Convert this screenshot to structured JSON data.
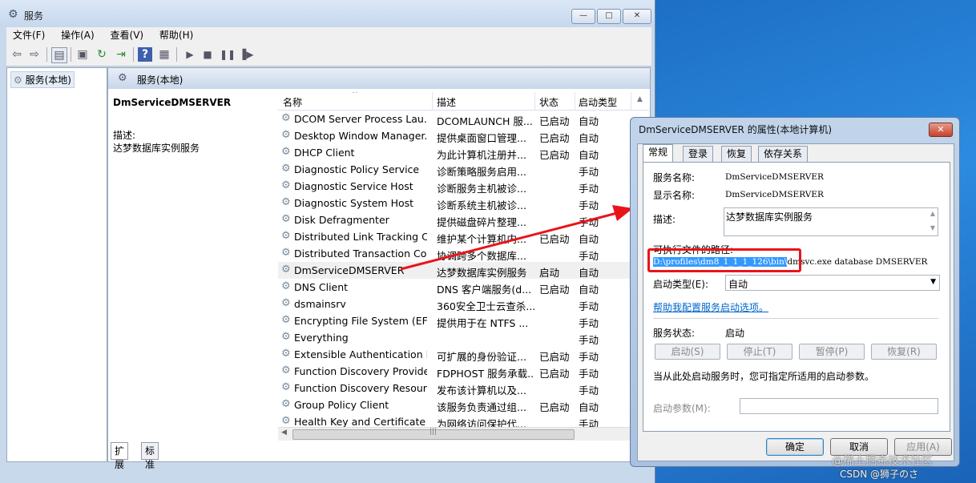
{
  "window": {
    "title": "服务",
    "controls": [
      "—",
      "□",
      "✕"
    ]
  },
  "menu": [
    "文件(F)",
    "操作(A)",
    "查看(V)",
    "帮助(H)"
  ],
  "left_tree": {
    "item": "服务(本地)"
  },
  "right_header": {
    "label": "服务(本地)"
  },
  "detail": {
    "service_name": "DmServiceDMSERVER",
    "desc_label": "描述:",
    "desc_text": "达梦数据库实例服务"
  },
  "columns": [
    "名称",
    "描述",
    "状态",
    "启动类型"
  ],
  "services": [
    {
      "name": "DCOM Server Process Lau...",
      "desc": "DCOMLAUNCH 服...",
      "status": "已启动",
      "start": "自动"
    },
    {
      "name": "Desktop Window Manager...",
      "desc": "提供桌面窗口管理...",
      "status": "已启动",
      "start": "自动"
    },
    {
      "name": "DHCP Client",
      "desc": "为此计算机注册并...",
      "status": "已启动",
      "start": "自动"
    },
    {
      "name": "Diagnostic Policy Service",
      "desc": "诊断策略服务启用...",
      "status": "",
      "start": "手动"
    },
    {
      "name": "Diagnostic Service Host",
      "desc": "诊断服务主机被诊...",
      "status": "",
      "start": "手动"
    },
    {
      "name": "Diagnostic System Host",
      "desc": "诊断系统主机被诊...",
      "status": "",
      "start": "手动"
    },
    {
      "name": "Disk Defragmenter",
      "desc": "提供磁盘碎片整理...",
      "status": "",
      "start": "手动"
    },
    {
      "name": "Distributed Link Tracking C...",
      "desc": "维护某个计算机内...",
      "status": "已启动",
      "start": "自动"
    },
    {
      "name": "Distributed Transaction Co...",
      "desc": "协调跨多个数据库...",
      "status": "",
      "start": "手动"
    },
    {
      "name": "DmServiceDMSERVER",
      "desc": "达梦数据库实例服务",
      "status": "启动",
      "start": "自动"
    },
    {
      "name": "DNS Client",
      "desc": "DNS 客户端服务(d...",
      "status": "已启动",
      "start": "自动"
    },
    {
      "name": "dsmainsrv",
      "desc": "360安全卫士云查杀...",
      "status": "",
      "start": "手动"
    },
    {
      "name": "Encrypting File System (EFS)",
      "desc": "提供用于在 NTFS ...",
      "status": "",
      "start": "手动"
    },
    {
      "name": "Everything",
      "desc": "",
      "status": "",
      "start": "手动"
    },
    {
      "name": "Extensible Authentication P...",
      "desc": "可扩展的身份验证...",
      "status": "已启动",
      "start": "手动"
    },
    {
      "name": "Function Discovery Provide...",
      "desc": "FDPHOST 服务承载...",
      "status": "已启动",
      "start": "手动"
    },
    {
      "name": "Function Discovery Resourc...",
      "desc": "发布该计算机以及...",
      "status": "",
      "start": "手动"
    },
    {
      "name": "Group Policy Client",
      "desc": "该服务负责通过组...",
      "status": "已启动",
      "start": "自动"
    },
    {
      "name": "Health Key and Certificate ...",
      "desc": "为网络访问保护代...",
      "status": "",
      "start": "手动"
    }
  ],
  "bottom_tabs": [
    "扩展",
    "标准"
  ],
  "dialog": {
    "title": "DmServiceDMSERVER 的属性(本地计算机)",
    "tabs": [
      "常规",
      "登录",
      "恢复",
      "依存关系"
    ],
    "service_name_label": "服务名称:",
    "service_name": "DmServiceDMSERVER",
    "display_name_label": "显示名称:",
    "display_name": "DmServiceDMSERVER",
    "desc_label": "描述:",
    "desc": "达梦数据库实例服务",
    "path_label": "可执行文件的路径:",
    "path_highlight": "D:\\profiles\\dm8_1_1_1_126\\bin\\",
    "path_rest": "dmsvc.exe database DMSERVER",
    "startup_type_label": "启动类型(E):",
    "startup_type": "自动",
    "help_link": "帮助我配置服务启动选项。",
    "status_label": "服务状态:",
    "status": "启动",
    "buttons": [
      "启动(S)",
      "停止(T)",
      "暂停(P)",
      "恢复(R)"
    ],
    "hint": "当从此处启动服务时，您可指定所适用的启动参数。",
    "param_label": "启动参数(M):",
    "ok": "确定",
    "cancel": "取消",
    "apply": "应用(A)"
  },
  "watermark": "@稀土掘金技术社区",
  "watermark2": "CSDN @狮子のさ"
}
